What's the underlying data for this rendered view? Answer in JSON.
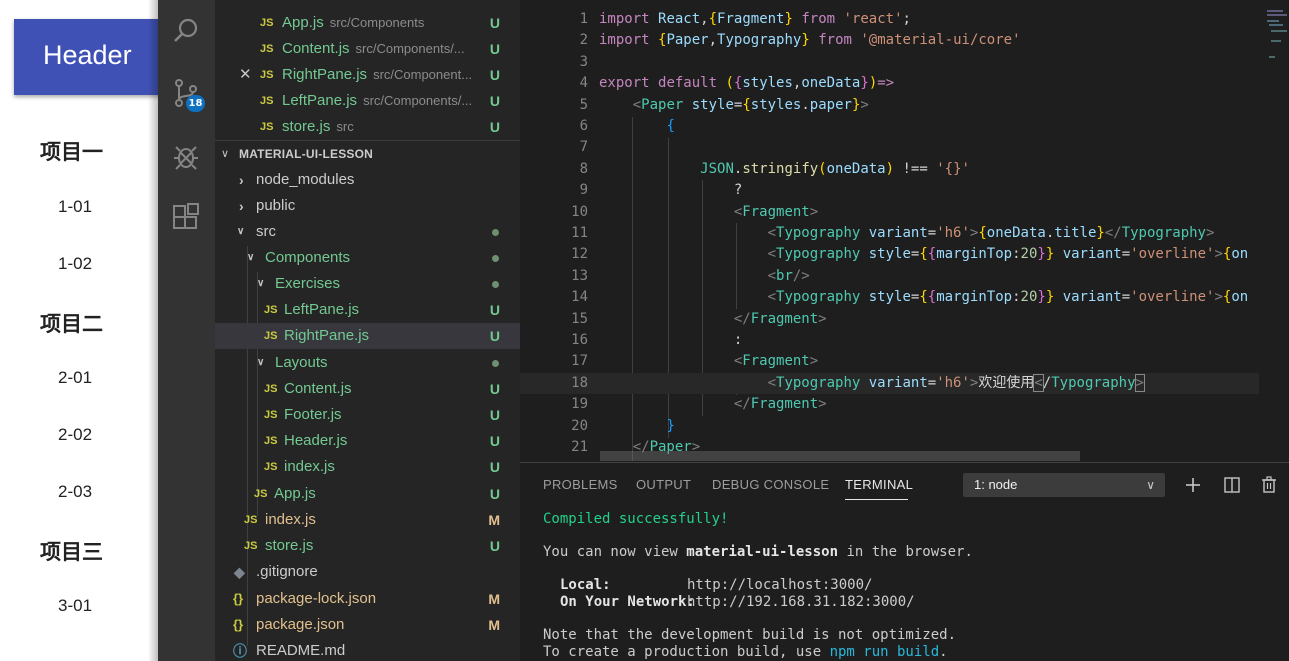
{
  "preview": {
    "header": "Header",
    "groups": [
      {
        "title": "项目一",
        "items": [
          "1-01",
          "1-02"
        ]
      },
      {
        "title": "项目二",
        "items": [
          "2-01",
          "2-02",
          "2-03"
        ]
      },
      {
        "title": "项目三",
        "items": [
          "3-01"
        ]
      }
    ]
  },
  "activity": {
    "scm_badge": "18"
  },
  "explorer": {
    "section_title": "MATERIAL-UI-LESSON",
    "open_editors": [
      {
        "name": "App.js",
        "path": "src/Components",
        "status": "U"
      },
      {
        "name": "Content.js",
        "path": "src/Components/...",
        "status": "U"
      },
      {
        "name": "RightPane.js",
        "path": "src/Component...",
        "status": "U"
      },
      {
        "name": "LeftPane.js",
        "path": "src/Components/...",
        "status": "U"
      },
      {
        "name": "store.js",
        "path": "src",
        "status": "U"
      }
    ],
    "tree": [
      {
        "name": "node_modules"
      },
      {
        "name": "public"
      },
      {
        "name": "src"
      },
      {
        "name": "Components"
      },
      {
        "name": "Exercises"
      },
      {
        "name": "LeftPane.js",
        "status": "U"
      },
      {
        "name": "RightPane.js",
        "status": "U"
      },
      {
        "name": "Layouts"
      },
      {
        "name": "Content.js",
        "status": "U"
      },
      {
        "name": "Footer.js",
        "status": "U"
      },
      {
        "name": "Header.js",
        "status": "U"
      },
      {
        "name": "index.js",
        "status": "U"
      },
      {
        "name": "App.js",
        "status": "U"
      },
      {
        "name": "index.js",
        "status": "M"
      },
      {
        "name": "store.js",
        "status": "U"
      },
      {
        "name": ".gitignore"
      },
      {
        "name": "package-lock.json",
        "status": "M"
      },
      {
        "name": "package.json",
        "status": "M"
      },
      {
        "name": "README.md"
      }
    ]
  },
  "editor": {
    "line_numbers": [
      "1",
      "2",
      "3",
      "4",
      "5",
      "6",
      "7",
      "8",
      "9",
      "10",
      "11",
      "12",
      "13",
      "14",
      "15",
      "16",
      "17",
      "18",
      "19",
      "20",
      "21"
    ]
  },
  "panel": {
    "tabs": [
      "PROBLEMS",
      "OUTPUT",
      "DEBUG CONSOLE",
      "TERMINAL"
    ],
    "terminal_select": "1: node",
    "terminal": {
      "compiled": "Compiled successfully!",
      "view_prefix": "You can now view ",
      "app_name": "material-ui-lesson",
      "view_suffix": " in the browser.",
      "local_label": "Local:",
      "local_url": "http://localhost:3000/",
      "network_label": "On Your Network:",
      "network_url": "http://192.168.31.182:3000/",
      "note": "Note that the development build is not optimized.",
      "build_prefix": "To create a production build, use ",
      "build_cmd": "npm run build",
      "build_suffix": "."
    }
  }
}
